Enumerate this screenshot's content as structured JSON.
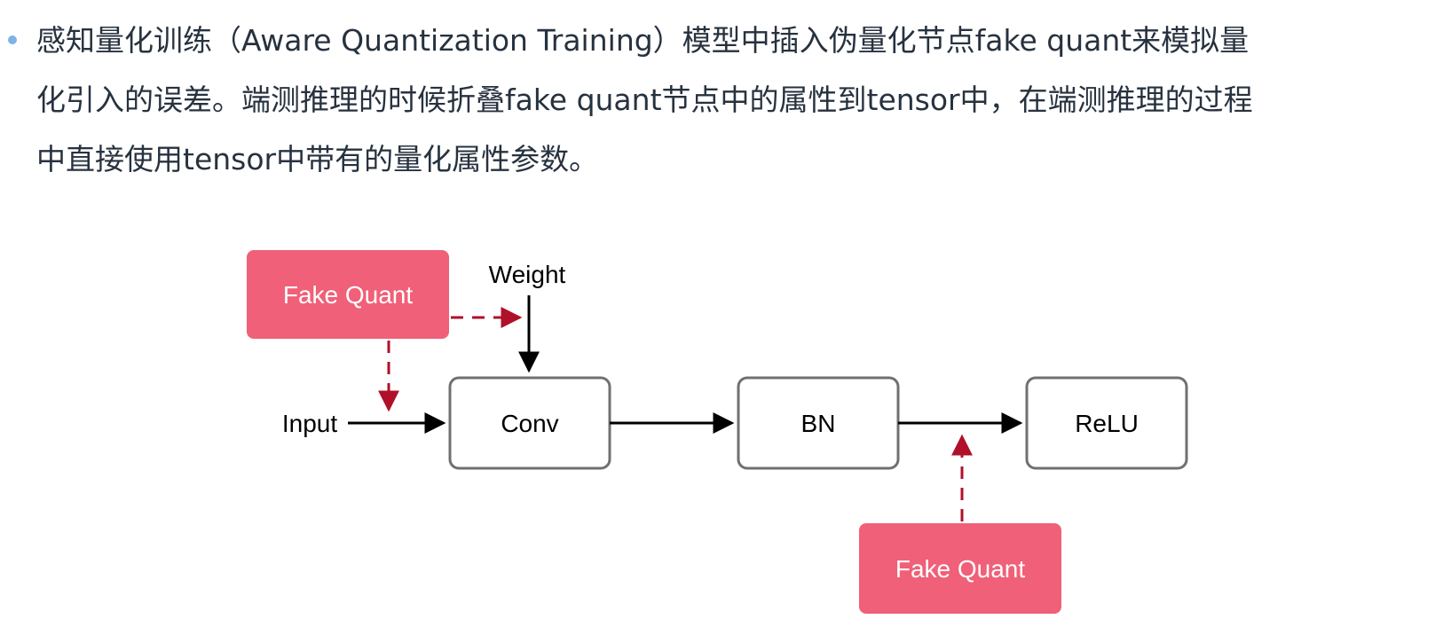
{
  "paragraph": {
    "lines": [
      "感知量化训练（Aware Quantization Training）模型中插入伪量化节点fake quant来模拟量",
      "化引入的误差。端测推理的时候折叠fake quant节点中的属性到tensor中，在端测推理的过程",
      "中直接使用tensor中带有的量化属性参数。"
    ]
  },
  "diagram": {
    "nodes": {
      "fake_quant_top": "Fake Quant",
      "weight": "Weight",
      "input": "Input",
      "conv": "Conv",
      "bn": "BN",
      "relu": "ReLU",
      "fake_quant_bottom": "Fake Quant"
    },
    "colors": {
      "fake_quant_fill": "#f06078",
      "dashed_arrow": "#b0102a",
      "box_border": "#707070",
      "bullet": "#7fb3e8"
    }
  }
}
